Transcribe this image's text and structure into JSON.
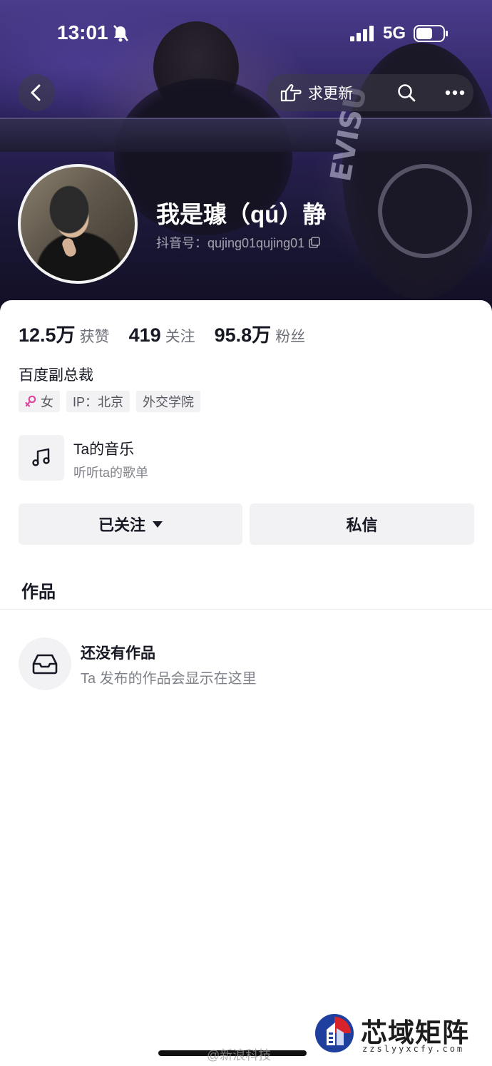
{
  "status_bar": {
    "time": "13:01",
    "network": "5G"
  },
  "top_bar": {
    "request_update_label": "求更新"
  },
  "profile": {
    "nickname": "我是璩（qú）静",
    "douyin_id": "抖音号：qujing01qujing01"
  },
  "stats": [
    {
      "value": "12.5万",
      "label": "获赞"
    },
    {
      "value": "419",
      "label": "关注"
    },
    {
      "value": "95.8万",
      "label": "粉丝"
    }
  ],
  "bio": "百度副总裁",
  "tags": {
    "gender": "女",
    "ip": "IP：北京",
    "school": "外交学院"
  },
  "music": {
    "title": "Ta的音乐",
    "subtitle": "听听ta的歌单"
  },
  "actions": {
    "follow_label": "已关注",
    "message_label": "私信"
  },
  "works": {
    "heading": "作品",
    "empty_title": "还没有作品",
    "empty_subtitle": "Ta 发布的作品会显示在这里"
  },
  "cover_text": {
    "brand": "EVISU"
  },
  "watermark": {
    "source": "@新浪科技",
    "site_name": "芯域矩阵",
    "site_url": "zzslyyxcfy.com"
  },
  "colors": {
    "gender_pink": "#e0479e",
    "text_primary": "#161823",
    "text_secondary": "#80828b"
  }
}
